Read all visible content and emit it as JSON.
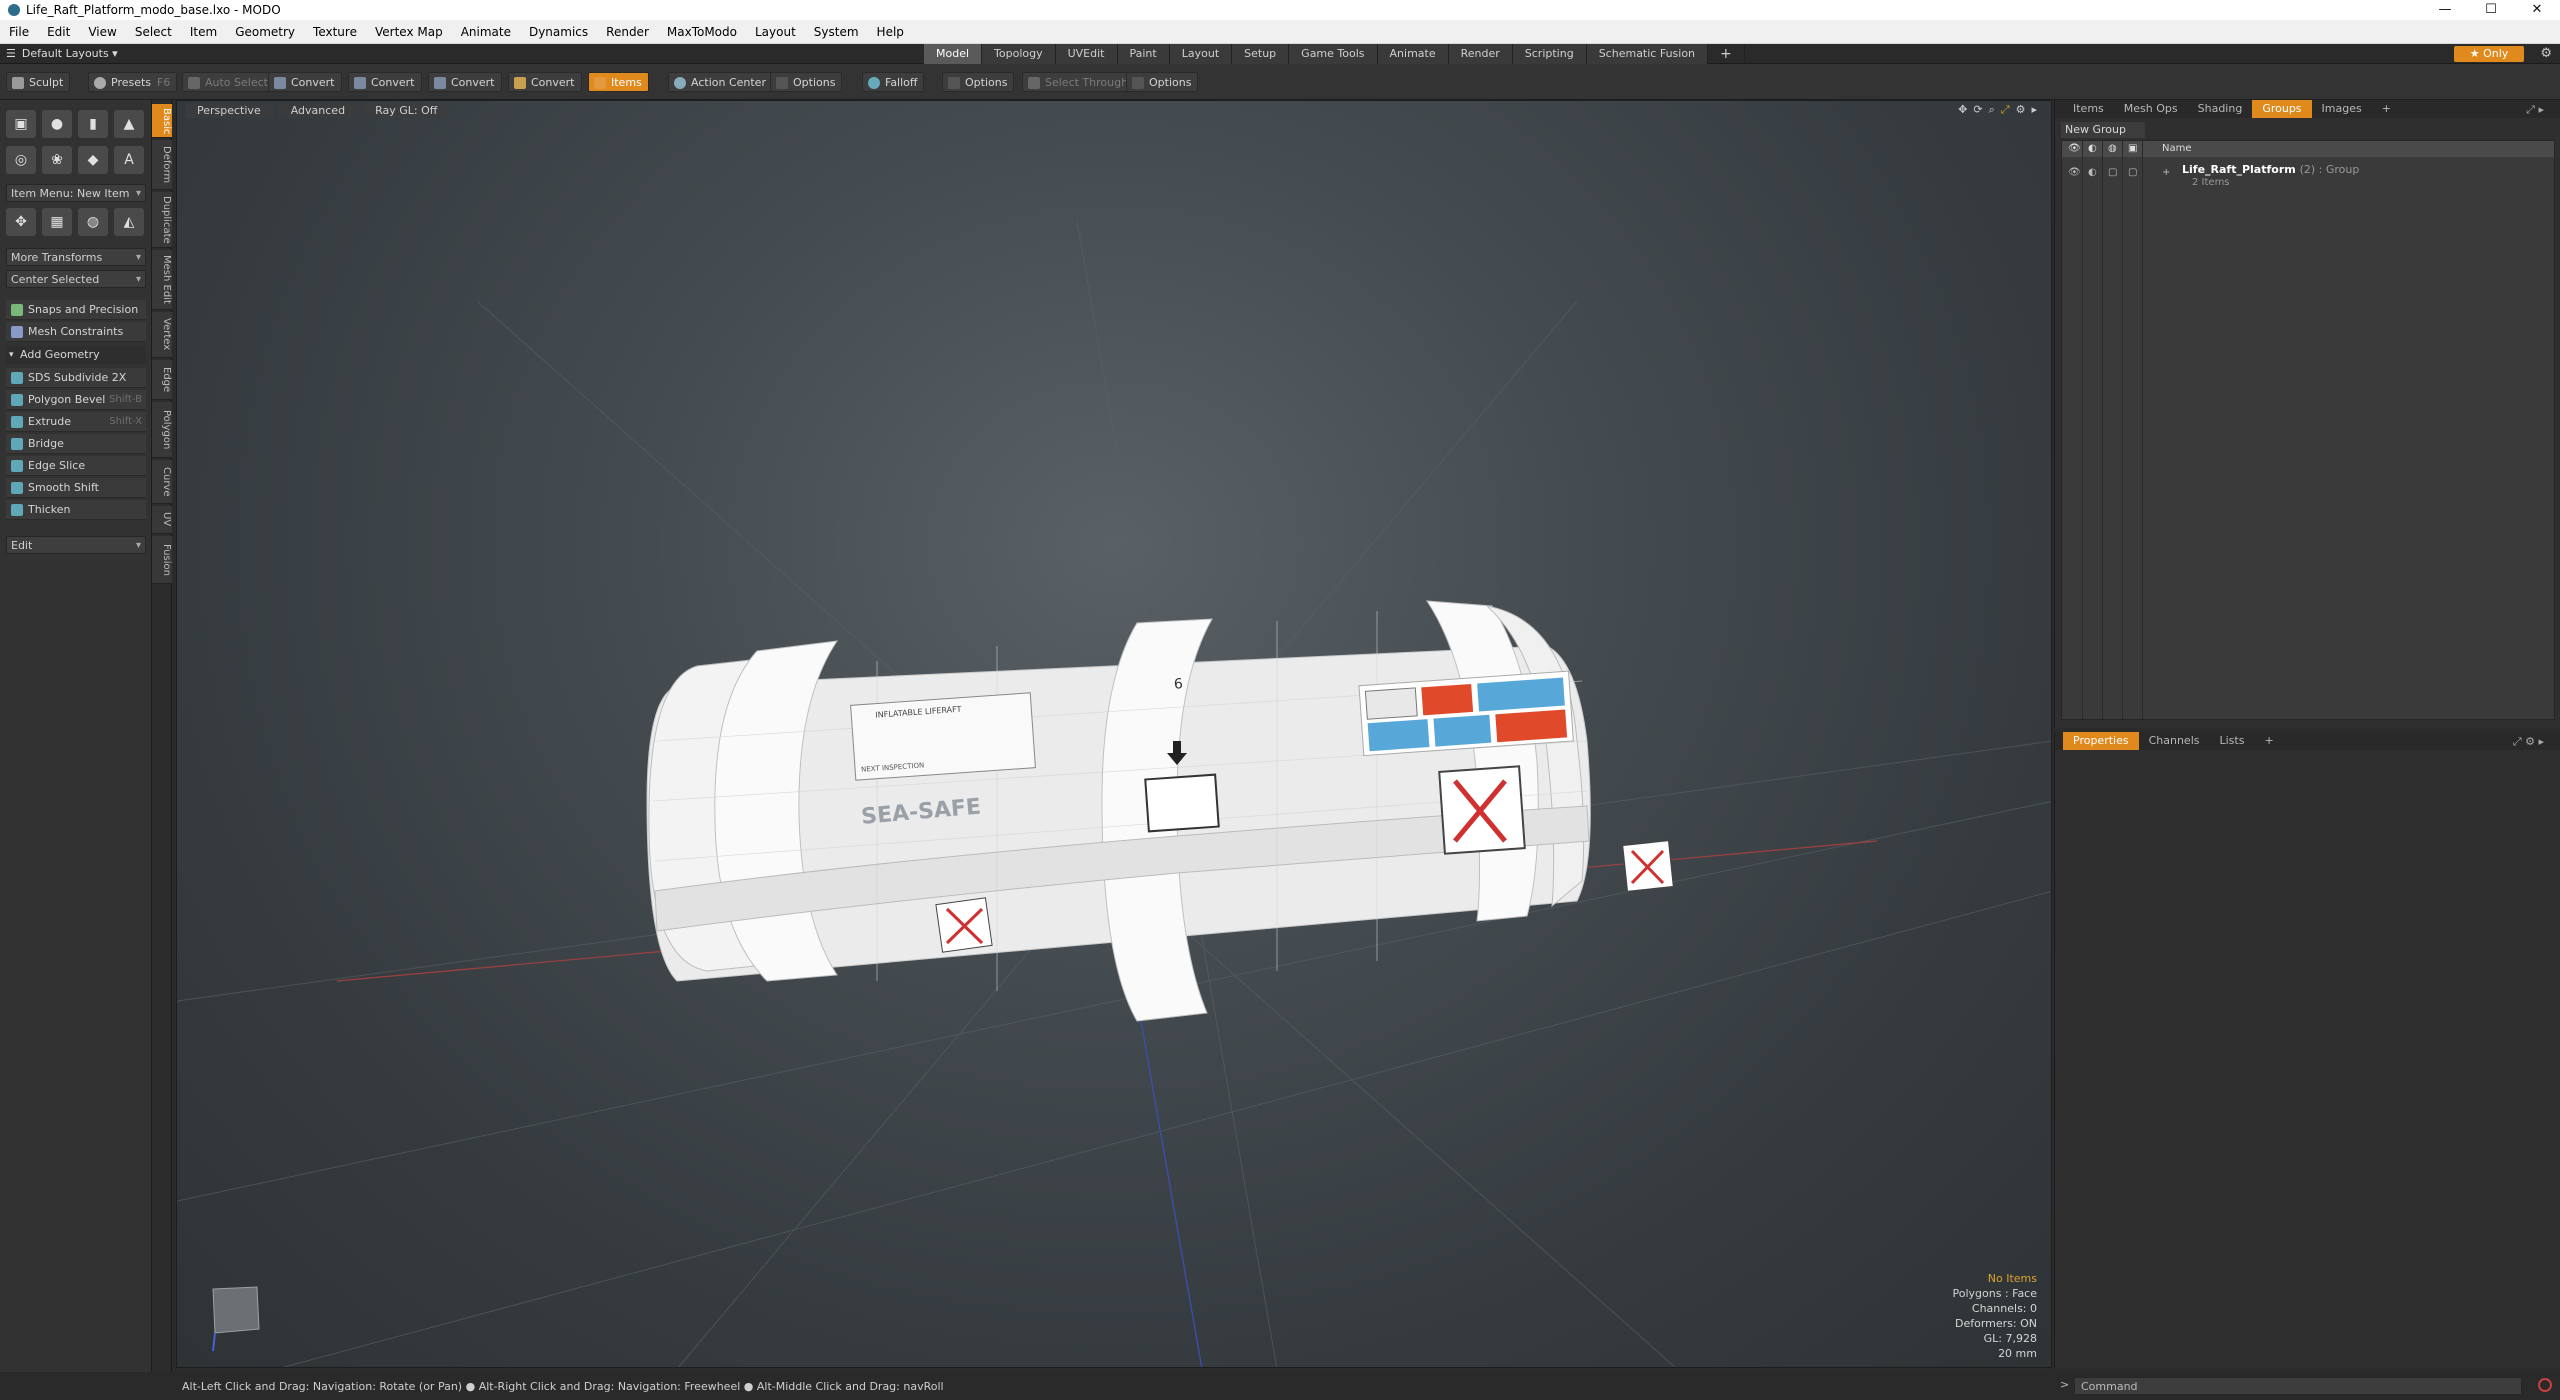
{
  "window": {
    "title": "Life_Raft_Platform_modo_base.lxo - MODO",
    "controls": [
      "—",
      "☐",
      "✕"
    ]
  },
  "menu": [
    "File",
    "Edit",
    "View",
    "Select",
    "Item",
    "Geometry",
    "Texture",
    "Vertex Map",
    "Animate",
    "Dynamics",
    "Render",
    "MaxToModo",
    "Layout",
    "System",
    "Help"
  ],
  "layoutbar": {
    "layout_selector": "Default Layouts ▾",
    "tabs": [
      "Model",
      "Topology",
      "UVEdit",
      "Paint",
      "Layout",
      "Setup",
      "Game Tools",
      "Animate",
      "Render",
      "Scripting",
      "Schematic Fusion"
    ],
    "active_tab": "Model",
    "plus": "+",
    "only_label": "★ Only",
    "gear": "⚙"
  },
  "toolbar": {
    "sculpt": "Sculpt",
    "presets": "Presets",
    "presets_hotkey": "F6",
    "auto_select": "Auto Select",
    "convert1": "Convert",
    "convert2": "Convert",
    "convert3": "Convert",
    "convert4": "Convert",
    "items": "Items",
    "action_center": "Action Center",
    "options1": "Options",
    "falloff": "Falloff",
    "options2": "Options",
    "select_through": "Select Through",
    "options3": "Options"
  },
  "toolbox": {
    "vertical_tabs": [
      "Basic",
      "Deform",
      "Duplicate",
      "Mesh Edit",
      "Vertex",
      "Edge",
      "Polygon",
      "Curve",
      "UV",
      "Fusion"
    ],
    "active_vtab": "Basic",
    "row1": [
      "▣",
      "●",
      "▮",
      "▲"
    ],
    "row2": [
      "◎",
      "❀",
      "◆",
      "A"
    ],
    "row3": [
      "✥",
      "▦",
      "◍",
      "◭"
    ],
    "item_menu": "Item Menu: New Item",
    "more_transforms": "More Transforms",
    "center_selected": "Center Selected",
    "snaps": "Snaps and Precision",
    "mesh_constraints": "Mesh Constraints",
    "add_geometry": "Add Geometry",
    "tools": [
      {
        "label": "SDS Subdivide 2X",
        "hotkey": ""
      },
      {
        "label": "Polygon Bevel",
        "hotkey": "Shift-B"
      },
      {
        "label": "Extrude",
        "hotkey": "Shift-X"
      },
      {
        "label": "Bridge",
        "hotkey": ""
      },
      {
        "label": "Edge Slice",
        "hotkey": ""
      },
      {
        "label": "Smooth Shift",
        "hotkey": ""
      },
      {
        "label": "Thicken",
        "hotkey": ""
      }
    ],
    "edit_dropdown": "Edit"
  },
  "viewport": {
    "view_mode": "Perspective",
    "shading": "Advanced",
    "raygl": "Ray GL: Off",
    "decals": {
      "brand": "SEA-SAFE",
      "plate_title": "INFLATABLE LIFERAFT",
      "plate_capacity": "6",
      "plate_inspection": "NEXT INSPECTION"
    },
    "info": {
      "no_items": "No Items",
      "polygons": "Polygons : Face",
      "channels": "Channels: 0",
      "deformers": "Deformers: ON",
      "gl": "GL: 7,928",
      "grid": "20 mm"
    }
  },
  "right_panel": {
    "top_tabs": [
      "Items",
      "Mesh Ops",
      "Shading",
      "Groups",
      "Images"
    ],
    "active_top_tab": "Groups",
    "new_group": "New Group",
    "list_header_name": "Name",
    "group": {
      "name": "Life_Raft_Platform",
      "kind": "(2) : Group",
      "count": "2 Items"
    },
    "bottom_tabs": [
      "Properties",
      "Channels",
      "Lists"
    ],
    "active_bottom_tab": "Properties"
  },
  "statusbar": {
    "hint": "Alt-Left Click and Drag: Navigation: Rotate (or Pan) ● Alt-Right Click and Drag: Navigation: Freewheel ● Alt-Middle Click and Drag: navRoll"
  },
  "command": {
    "placeholder": "Command"
  }
}
